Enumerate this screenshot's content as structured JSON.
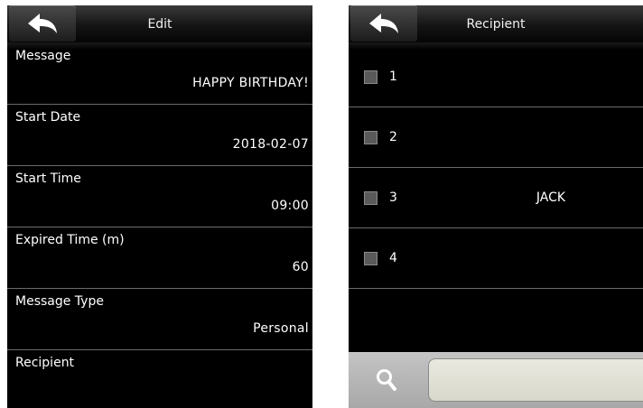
{
  "edit_screen": {
    "title": "Edit",
    "fields": [
      {
        "label": "Message",
        "value": "HAPPY BIRTHDAY!"
      },
      {
        "label": "Start Date",
        "value": "2018-02-07"
      },
      {
        "label": "Start Time",
        "value": "09:00"
      },
      {
        "label": "Expired Time (m)",
        "value": "60"
      },
      {
        "label": "Message Type",
        "value": "Personal"
      },
      {
        "label": "Recipient",
        "value": ""
      }
    ]
  },
  "recipient_screen": {
    "title": "Recipient",
    "rows": [
      {
        "number": "1",
        "name": "",
        "checked": false
      },
      {
        "number": "2",
        "name": "",
        "checked": false
      },
      {
        "number": "3",
        "name": "JACK",
        "checked": false
      },
      {
        "number": "4",
        "name": "",
        "checked": false
      }
    ],
    "search": {
      "placeholder": "",
      "value": ""
    }
  },
  "icons": {
    "back": "back-arrow-icon",
    "search": "magnifier-icon",
    "checkbox": "checkbox-unchecked-icon"
  },
  "colors": {
    "background": "#000000",
    "header": "#1e1e1e",
    "divider": "#6b6b6b",
    "search_bar": "#b6b6b6",
    "checkbox": "#5a5a5a"
  }
}
